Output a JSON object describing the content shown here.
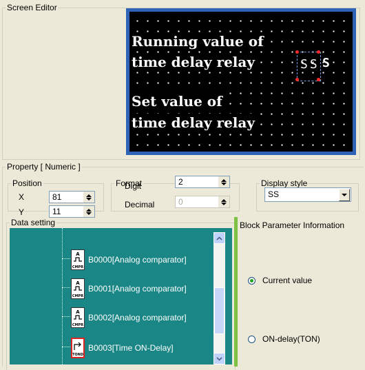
{
  "screen_editor": {
    "legend": "Screen Editor",
    "lcd": {
      "line1": "Running value of",
      "line2": "time delay relay",
      "line3": "Set value of",
      "line4": "time delay relay",
      "field_value": "SS",
      "field_suffix": "S"
    }
  },
  "property": {
    "legend": "Property [ Numeric ]",
    "position": {
      "legend": "Position",
      "x_label": "X",
      "x_value": "81",
      "y_label": "Y",
      "y_value": "11"
    },
    "format": {
      "legend": "Format",
      "digit_label": "Digit",
      "digit_value": "2",
      "decimal_label": "Decimal",
      "decimal_value": "0"
    },
    "display_style": {
      "legend": "Display style",
      "selected": "SS"
    },
    "data_setting": {
      "legend": "Data setting",
      "items": [
        {
          "label": "B0000[Analog comparator]",
          "icon_text": "CMPR"
        },
        {
          "label": "B0001[Analog comparator]",
          "icon_text": "CMPR"
        },
        {
          "label": "B0002[Analog comparator]",
          "icon_text": "CMPR"
        },
        {
          "label": "B0003[Time ON-Delay]",
          "icon_text": "TOND"
        }
      ]
    },
    "block_param": {
      "title": "Block Parameter Information",
      "option_current": "Current value",
      "option_ton": "ON-delay(TON)"
    }
  },
  "colors": {
    "tree_bg": "#1A8686",
    "lcd_border": "#2F63B8",
    "accent_green": "#21A121"
  }
}
